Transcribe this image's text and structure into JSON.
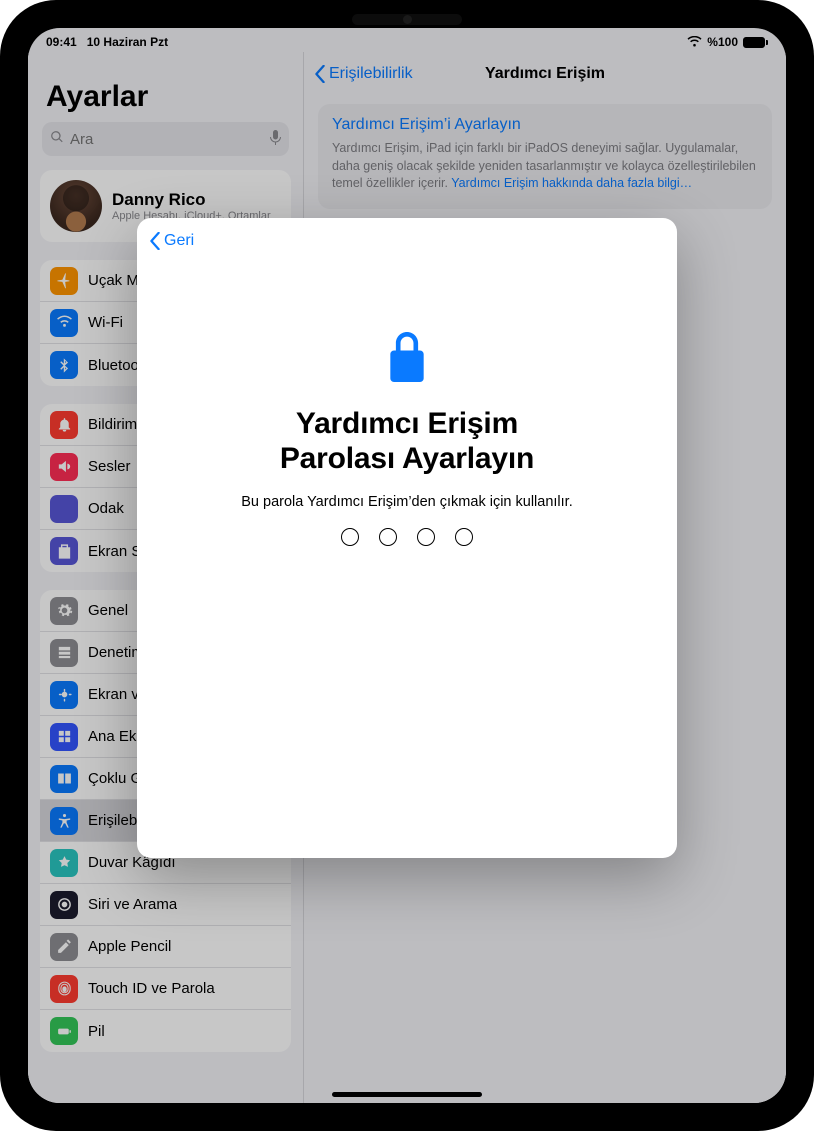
{
  "status": {
    "time": "09:41",
    "date": "10 Haziran Pzt",
    "wifi": "􀙇",
    "battery_text": "%100"
  },
  "sidebar": {
    "title": "Ayarlar",
    "search_placeholder": "Ara",
    "account": {
      "name": "Danny Rico",
      "subtitle": "Apple Hesabı, iCloud+, Ortamlar"
    },
    "groups": [
      {
        "items": [
          {
            "id": "airplane",
            "label": "Uçak Modu",
            "color": "#ff9500"
          },
          {
            "id": "wifi",
            "label": "Wi-Fi",
            "color": "#0a7aff"
          },
          {
            "id": "bluetooth",
            "label": "Bluetooth",
            "color": "#0a7aff"
          }
        ]
      },
      {
        "items": [
          {
            "id": "notifications",
            "label": "Bildirimler",
            "color": "#ff3b30"
          },
          {
            "id": "sounds",
            "label": "Sesler",
            "color": "#ff2d55"
          },
          {
            "id": "focus",
            "label": "Odak",
            "color": "#5856d6"
          },
          {
            "id": "screentime",
            "label": "Ekran Süresi",
            "color": "#5856d6"
          }
        ]
      },
      {
        "items": [
          {
            "id": "general",
            "label": "Genel",
            "color": "#8e8e93"
          },
          {
            "id": "controlcenter",
            "label": "Denetim Merkezi",
            "color": "#8e8e93"
          },
          {
            "id": "display",
            "label": "Ekran ve Parlaklık",
            "color": "#0a7aff"
          },
          {
            "id": "homescreen",
            "label": "Ana Ekran ve Uygulama Arşivi",
            "color": "#3355ff"
          },
          {
            "id": "multitask",
            "label": "Çoklu Görev",
            "color": "#0a7aff"
          },
          {
            "id": "accessibility",
            "label": "Erişilebilirlik",
            "color": "#0a7aff",
            "selected": true
          },
          {
            "id": "wallpaper",
            "label": "Duvar Kâğıdı",
            "color": "#29c6c0"
          },
          {
            "id": "siri",
            "label": "Siri ve Arama",
            "color": "#1b1b2e"
          },
          {
            "id": "pencil",
            "label": "Apple Pencil",
            "color": "#8e8e93"
          },
          {
            "id": "touchid",
            "label": "Touch ID ve Parola",
            "color": "#ff3b30"
          },
          {
            "id": "battery",
            "label": "Pil",
            "color": "#34c759"
          }
        ]
      }
    ]
  },
  "detail": {
    "back_label": "Erişilebilirlik",
    "title": "Yardımcı Erişim",
    "panel_title": "Yardımcı Erişim’i Ayarlayın",
    "panel_desc": "Yardımcı Erişim, iPad için farklı bir iPadOS deneyimi sağlar. Uygulamalar, daha geniş olacak şekilde yeniden tasarlanmıştır ve kolayca özelleştirilebilen temel özellikler içerir. ",
    "panel_link": "Yardımcı Erişim hakkında daha fazla bilgi…"
  },
  "modal": {
    "back_label": "Geri",
    "title_line1": "Yardımcı Erişim",
    "title_line2": "Parolası Ayarlayın",
    "subtitle": "Bu parola Yardımcı Erişim’den çıkmak için kullanılır.",
    "digits": 4
  },
  "colors": {
    "ios_blue": "#0a7aff"
  }
}
